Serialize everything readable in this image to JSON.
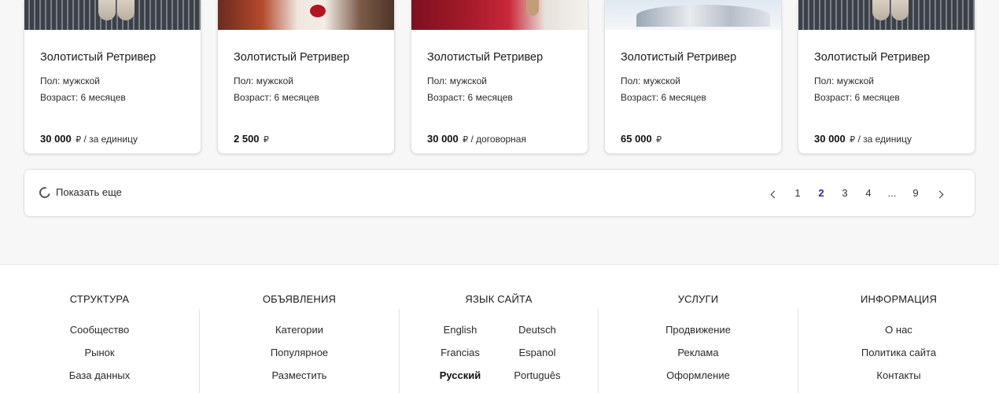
{
  "listings": [
    {
      "title": "Золотистый Ретривер",
      "gender": "Пол: мужской",
      "age": "Возраст: 6 месяцев",
      "price": "30 000",
      "currency": "₽",
      "price_note": "/ за единицу"
    },
    {
      "title": "Золотистый Ретривер",
      "gender": "Пол: мужской",
      "age": "Возраст: 6 месяцев",
      "price": "2 500",
      "currency": "₽",
      "price_note": ""
    },
    {
      "title": "Золотистый Ретривер",
      "gender": "Пол: мужской",
      "age": "Возраст: 6 месяцев",
      "price": "30 000",
      "currency": "₽",
      "price_note": "/ договорная"
    },
    {
      "title": "Золотистый Ретривер",
      "gender": "Пол: мужской",
      "age": "Возраст: 6 месяцев",
      "price": "65 000",
      "currency": "₽",
      "price_note": ""
    },
    {
      "title": "Золотистый Ретривер",
      "gender": "Пол: мужской",
      "age": "Возраст: 6 месяцев",
      "price": "30 000",
      "currency": "₽",
      "price_note": "/ за единицу"
    }
  ],
  "pager": {
    "show_more": "Показать еще",
    "pages": [
      "1",
      "2",
      "3",
      "4",
      "...",
      "9"
    ],
    "current": "2"
  },
  "footer": {
    "structure": {
      "title": "СТРУКТУРА",
      "links": [
        "Сообщество",
        "Рынок",
        "База данных"
      ]
    },
    "ads": {
      "title": "ОБЪЯВЛЕНИЯ",
      "links": [
        "Категории",
        "Популярное",
        "Разместить"
      ]
    },
    "language": {
      "title": "ЯЗЫК САЙТА",
      "options": [
        "English",
        "Deutsch",
        "Francias",
        "Espanol",
        "Русский",
        "Português"
      ],
      "current": "Русский"
    },
    "services": {
      "title": "УСЛУГИ",
      "links": [
        "Продвижение",
        "Реклама",
        "Оформление"
      ]
    },
    "info": {
      "title": "ИНФОРМАЦИЯ",
      "links": [
        "О нас",
        "Политика сайта",
        "Контакты"
      ]
    }
  },
  "colors": {
    "accent": "#2c2aa8",
    "background": "#f7f7f7",
    "card": "#ffffff"
  }
}
